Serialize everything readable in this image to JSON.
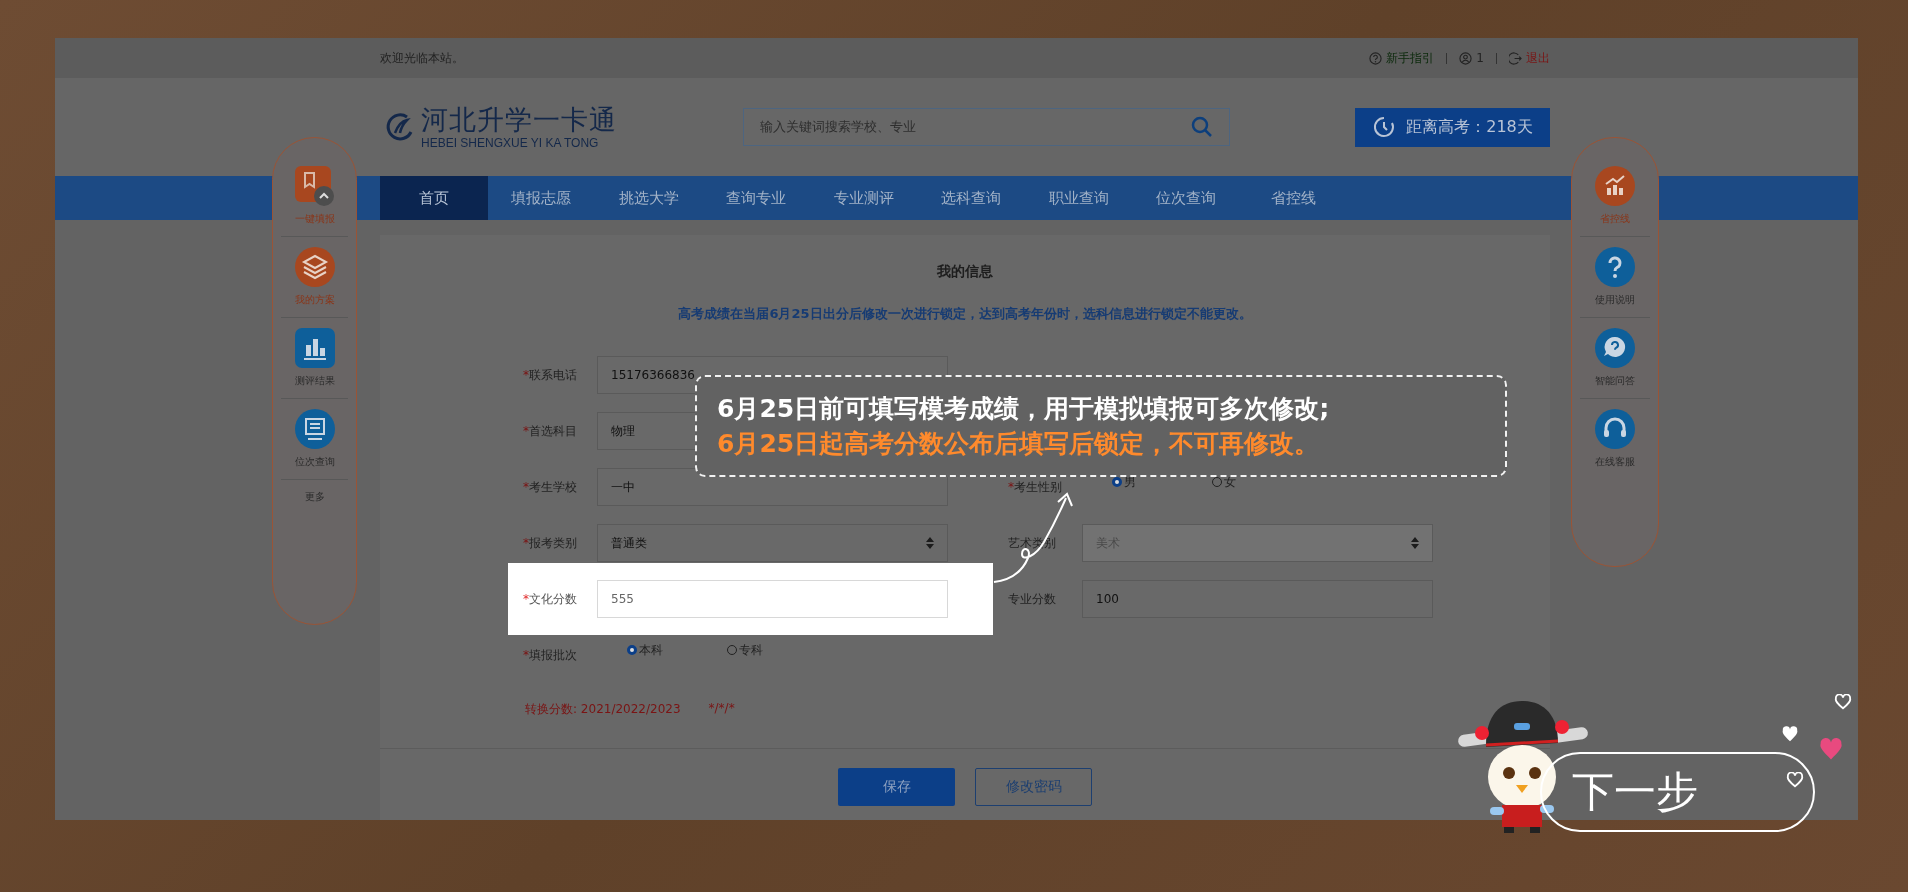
{
  "top_bar": {
    "welcome": "欢迎光临本站。",
    "links": [
      {
        "kind": "guide",
        "label": "新手指引"
      },
      {
        "kind": "user",
        "label": "1"
      },
      {
        "kind": "logout",
        "label": "退出"
      }
    ]
  },
  "header": {
    "logo_title": "河北升学一卡通",
    "logo_subtitle": "HEBEI SHENGXUE YI KA TONG",
    "search": {
      "placeholder": "输入关键词搜索学校、专业"
    },
    "countdown": "距离高考：218天"
  },
  "nav": [
    {
      "label": "首页",
      "selected": true
    },
    {
      "label": "填报志愿",
      "selected": false
    },
    {
      "label": "挑选大学",
      "selected": false
    },
    {
      "label": "查询专业",
      "selected": false
    },
    {
      "label": "专业测评",
      "selected": false
    },
    {
      "label": "选科查询",
      "selected": false
    },
    {
      "label": "职业查询",
      "selected": false
    },
    {
      "label": "位次查询",
      "selected": false
    },
    {
      "label": "省控线",
      "selected": false
    }
  ],
  "left_dock": [
    {
      "kind": "book",
      "label": "一键填报",
      "highlighted": true
    },
    {
      "kind": "layers",
      "label": "我的方案",
      "highlighted": true
    },
    {
      "kind": "bars",
      "label": "测评结果",
      "highlighted": false
    },
    {
      "kind": "monitor",
      "label": "位次查询",
      "highlighted": false
    },
    {
      "kind": "more",
      "label": "更多",
      "highlighted": false
    }
  ],
  "right_dock": [
    {
      "kind": "chart",
      "label": "省控线",
      "highlighted": true
    },
    {
      "kind": "question",
      "label": "使用说明",
      "highlighted": false
    },
    {
      "kind": "chat",
      "label": "智能问答",
      "highlighted": false
    },
    {
      "kind": "headset",
      "label": "在线客服",
      "highlighted": false
    }
  ],
  "form": {
    "title": "我的信息",
    "notice": "高考成绩在当届6月25日出分后修改一次进行锁定，达到高考年份时，选科信息进行锁定不能更改。",
    "rows": [
      {
        "left": {
          "kind": "input",
          "mark": "*",
          "label": "联系电话",
          "value": "15176366836",
          "disabled": false,
          "highlighted": false
        },
        "right": null
      },
      {
        "left": {
          "kind": "select",
          "mark": "*",
          "label": "首选科目",
          "value": "物理",
          "disabled": false,
          "highlighted": false
        },
        "right": null
      },
      {
        "left": {
          "kind": "input",
          "mark": "*",
          "label": "考生学校",
          "value": "一中",
          "disabled": false,
          "highlighted": false
        },
        "right": {
          "kind": "radio",
          "mark": "*",
          "label": "考生性别",
          "disabled": false,
          "highlighted": false,
          "options": [
            {
              "label": "男",
              "selected": true
            },
            {
              "label": "女",
              "selected": false
            }
          ]
        }
      },
      {
        "left": {
          "kind": "select",
          "mark": "*",
          "label": "报考类别",
          "value": "普通类",
          "disabled": false,
          "highlighted": false
        },
        "right": {
          "kind": "select",
          "label": "艺术类别",
          "value": "美术",
          "disabled": true,
          "highlighted": false
        }
      },
      {
        "left": {
          "kind": "input",
          "mark": "*",
          "label": "文化分数",
          "value": "555",
          "disabled": false,
          "highlighted": true
        },
        "right": {
          "kind": "input",
          "label": "专业分数",
          "value": "100",
          "disabled": false,
          "highlighted": false
        }
      },
      {
        "left": {
          "kind": "radio",
          "mark": "*",
          "label": "填报批次",
          "disabled": false,
          "highlighted": false,
          "options": [
            {
              "label": "本科",
              "selected": true
            },
            {
              "label": "专科",
              "selected": false
            }
          ]
        },
        "right": null
      }
    ],
    "conversion_label": "转换分数: 2021/2022/2023",
    "conversion_value": "*/*/*",
    "buttons": [
      {
        "kind": "primary",
        "label": "保存"
      },
      {
        "kind": "outline",
        "label": "修改密码"
      }
    ]
  },
  "tooltip": {
    "line_1": "6月25日前可填写模考成绩，用于模拟填报可多次修改;",
    "line_2": "6月25日起高考分数公布后填写后锁定，不可再修改。"
  },
  "next_button": "下一步"
}
